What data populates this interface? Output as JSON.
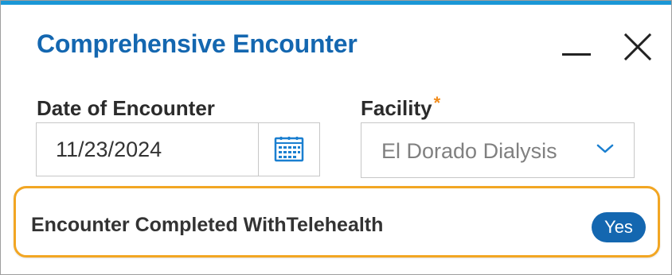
{
  "dialog": {
    "title": "Comprehensive Encounter",
    "accent_color": "#1a97d6",
    "title_color": "#1467b0"
  },
  "window_controls": {
    "minimize_icon": "minimize-icon",
    "close_icon": "close-icon"
  },
  "date_field": {
    "label": "Date of Encounter",
    "value": "11/23/2024",
    "icon": "calendar-icon"
  },
  "facility_field": {
    "label": "Facility",
    "required_marker": "*",
    "selected_value": "El Dorado Dialysis",
    "icon": "chevron-down-icon",
    "required_color": "#f28c1b"
  },
  "telehealth": {
    "label": "Encounter Completed WithTelehealth",
    "value": "Yes",
    "highlight_color": "#f2a623",
    "pill_color": "#1467b0"
  }
}
